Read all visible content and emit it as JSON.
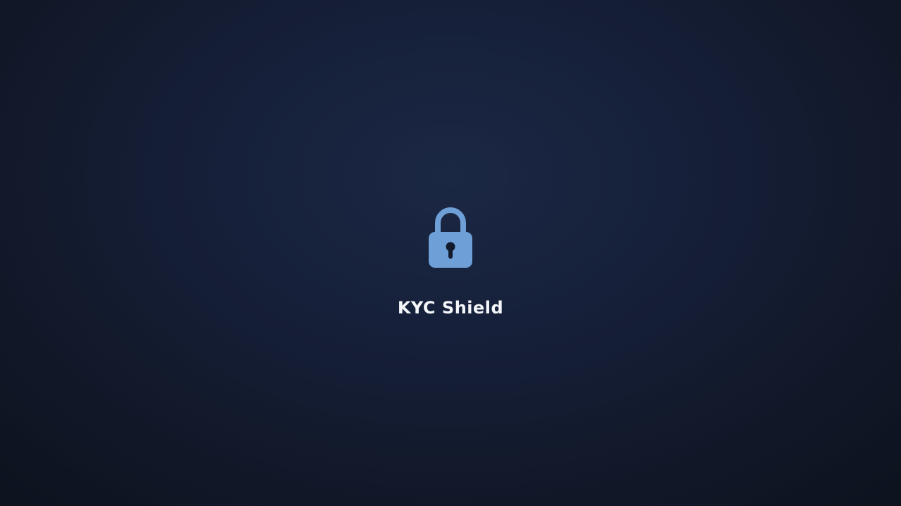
{
  "app": {
    "name": "KYC Shield",
    "icon": "lock-icon"
  },
  "colors": {
    "background": "#16203a",
    "lock": "#6e9fd6",
    "keyhole": "#121a2c",
    "title": "#f4f6fa"
  }
}
